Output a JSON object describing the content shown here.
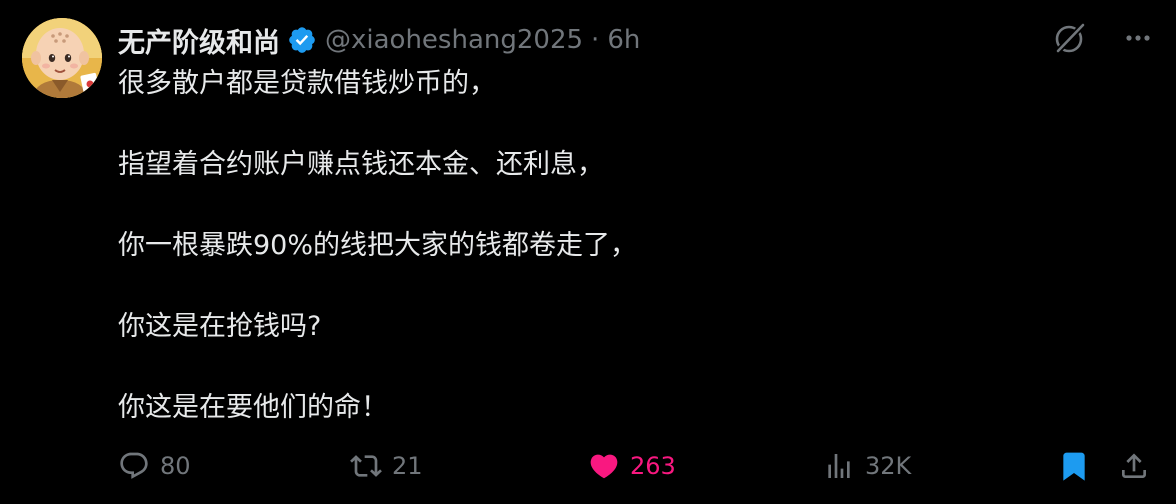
{
  "post": {
    "author": {
      "display_name": "无产阶级和尚",
      "handle": "@xiaoheshang2025",
      "verified_badge_icon": "verified-badge-icon",
      "avatar": "avatar-monk-cartoon"
    },
    "separator": "·",
    "time": "6h",
    "paragraphs": [
      "很多散户都是贷款借钱炒币的，",
      "指望着合约账户赚点钱还本金、还利息，",
      "你一根暴跌90%的线把大家的钱都卷走了，",
      "你这是在抢钱吗?",
      "你这是在要他们的命！"
    ],
    "top_actions": {
      "grok_icon": "grok-icon",
      "more_icon": "more-icon"
    },
    "stats": {
      "replies": "80",
      "reposts": "21",
      "likes": "263",
      "views": "32K"
    },
    "icons": {
      "reply": "reply-icon",
      "repost": "repost-icon",
      "like": "heart-icon",
      "views": "views-icon",
      "bookmark": "bookmark-icon",
      "share": "share-icon"
    },
    "colors": {
      "background": "#000000",
      "text": "#e7e9ea",
      "muted": "#71767b",
      "like": "#f91880",
      "bookmark": "#1d9bf0",
      "verified": "#1d9bf0"
    }
  }
}
